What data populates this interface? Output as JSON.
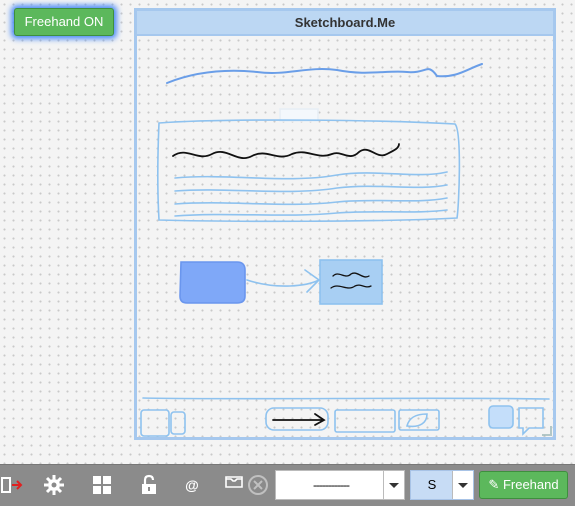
{
  "freehand_toggle": {
    "label": "Freehand ON"
  },
  "board": {
    "title": "Sketchboard.Me"
  },
  "toolbar": {
    "icons": [
      "exit-icon",
      "gear-icon",
      "grid-icon",
      "lock-icon",
      "at-icon",
      "tray-icon",
      "close-circle-icon"
    ],
    "at_symbol": "@",
    "line_style_value": "------------",
    "size_value": "S",
    "freehand_label": "Freehand"
  },
  "colors": {
    "sketch_blue": "#8ec2ef",
    "board_border": "#a6c8ee",
    "green_button": "#5cb85c",
    "toolbar_bg": "#8b8b8b",
    "filled_shape": "#7fa8f8"
  }
}
